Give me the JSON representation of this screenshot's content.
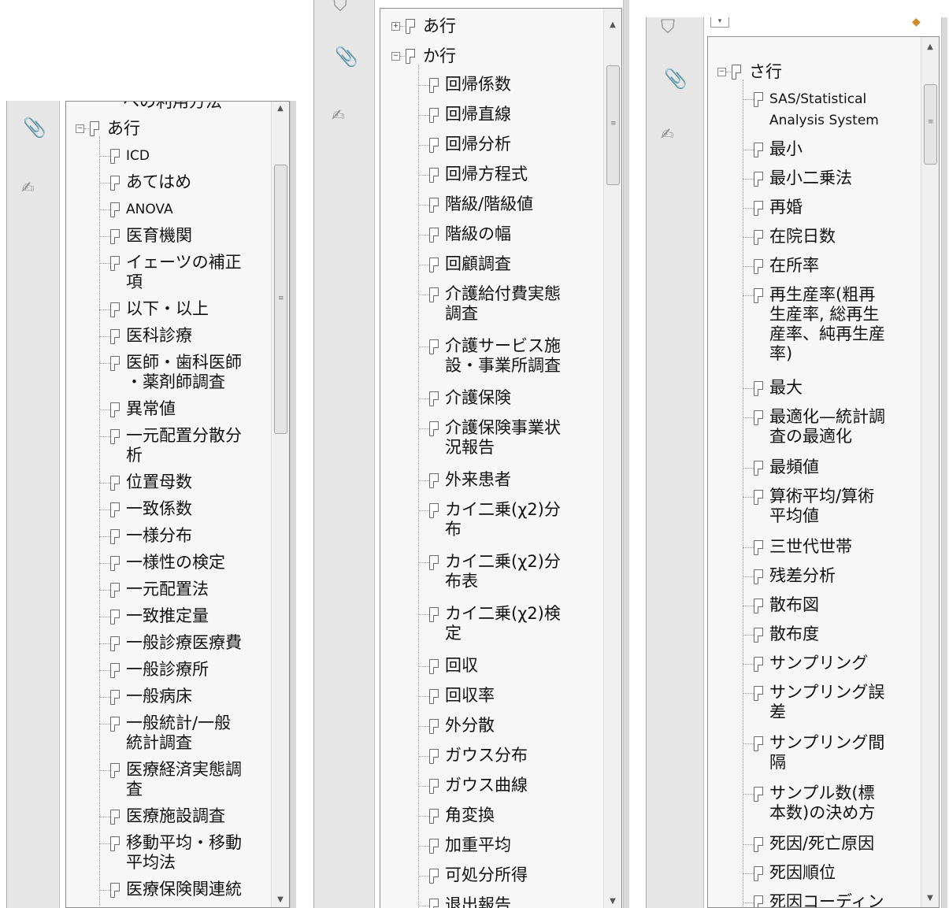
{
  "panels": [
    {
      "id": "p1",
      "rail_icons": [
        "paperclip-icon",
        "signature-icon"
      ],
      "top_item": "への利用方法",
      "group": {
        "label": "あ行",
        "expanded": true
      },
      "items": [
        "ICD",
        "あてはめ",
        "ANOVA",
        "医育機関",
        "イェーツの補正\n項",
        "以下・以上",
        "医科診療",
        "医師・歯科医師\n・薬剤師調査",
        "異常値",
        "一元配置分散分\n析",
        "位置母数",
        "一致係数",
        "一様分布",
        "一様性の検定",
        "一元配置法",
        "一致推定量",
        "一般診療医療費",
        "一般診療所",
        "一般病床",
        "一般統計/一般\n統計調査",
        "医療経済実態調\n査",
        "医療施設調査",
        "移動平均・移動\n平均法",
        "医療保険関連統"
      ]
    },
    {
      "id": "p2",
      "rail_icons": [
        "bookmark-icon",
        "paperclip-icon",
        "signature-icon"
      ],
      "groups": [
        {
          "label": "あ行",
          "expanded": false
        },
        {
          "label": "か行",
          "expanded": true
        }
      ],
      "items": [
        "回帰係数",
        "回帰直線",
        "回帰分析",
        "回帰方程式",
        "階級/階級値",
        "階級の幅",
        "回顧調査",
        "介護給付費実態\n調査",
        "介護サービス施\n設・事業所調査",
        "介護保険",
        "介護保険事業状\n況報告",
        "外来患者",
        "カイ二乗(χ2)分\n布",
        "カイ二乗(χ2)分\n布表",
        "カイ二乗(χ2)検\n定",
        "回収",
        "回収率",
        "外分散",
        "ガウス分布",
        "ガウス曲線",
        "角変換",
        "加重平均",
        "可処分所得",
        "退出報告"
      ]
    },
    {
      "id": "p3",
      "rail_icons": [
        "bookmark-icon",
        "paperclip-icon",
        "signature-icon"
      ],
      "toolbar_icons": [
        "options-icon",
        "expand-bookmark-icon"
      ],
      "group": {
        "label": "さ行",
        "expanded": true
      },
      "items": [
        "SAS/Statistical\nAnalysis System",
        "最小",
        "最小二乗法",
        "再婚",
        "在院日数",
        "在所率",
        "再生産率(粗再\n生産率, 総再生\n産率、純再生産\n率)",
        "最大",
        "最適化—統計調\n査の最適化",
        "最頻値",
        "算術平均/算術\n平均値",
        "三世代世帯",
        "残差分析",
        "散布図",
        "散布度",
        "サンプリング",
        "サンプリング誤\n差",
        "サンプリング間\n隔",
        "サンプル数(標\n本数)の決め方",
        "死因/死亡原因",
        "死因順位",
        "死因コーディン\nグ"
      ]
    }
  ]
}
